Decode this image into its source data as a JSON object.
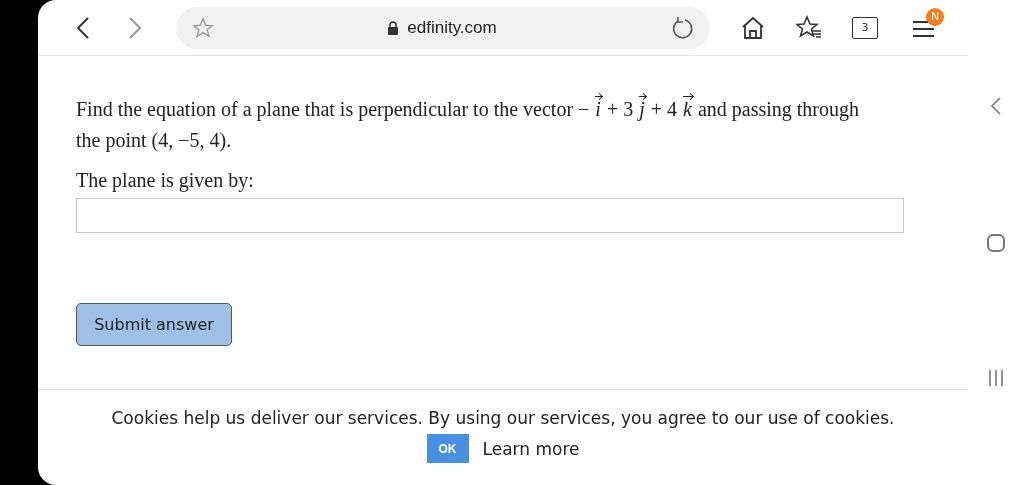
{
  "toolbar": {
    "url": "edfinity.com",
    "tab_count": "3",
    "menu_badge": "N"
  },
  "question": {
    "parts": [
      {
        "kind": "text",
        "text": "Find the equation of a plane that is perpendicular to the vector − "
      },
      {
        "kind": "vector",
        "text": "i"
      },
      {
        "kind": "text",
        "text": " + 3 "
      },
      {
        "kind": "vector",
        "text": "j"
      },
      {
        "kind": "text",
        "text": " + 4 "
      },
      {
        "kind": "vector",
        "text": "k"
      },
      {
        "kind": "text",
        "text": " and passing through the point (4, −5, 4)."
      }
    ],
    "prompt": "The plane is given by:",
    "submit": "Submit answer"
  },
  "cookie_banner": {
    "text": "Cookies help us deliver our services. By using our services, you agree to our use of cookies.",
    "ok": "OK",
    "learn_more": "Learn more"
  }
}
